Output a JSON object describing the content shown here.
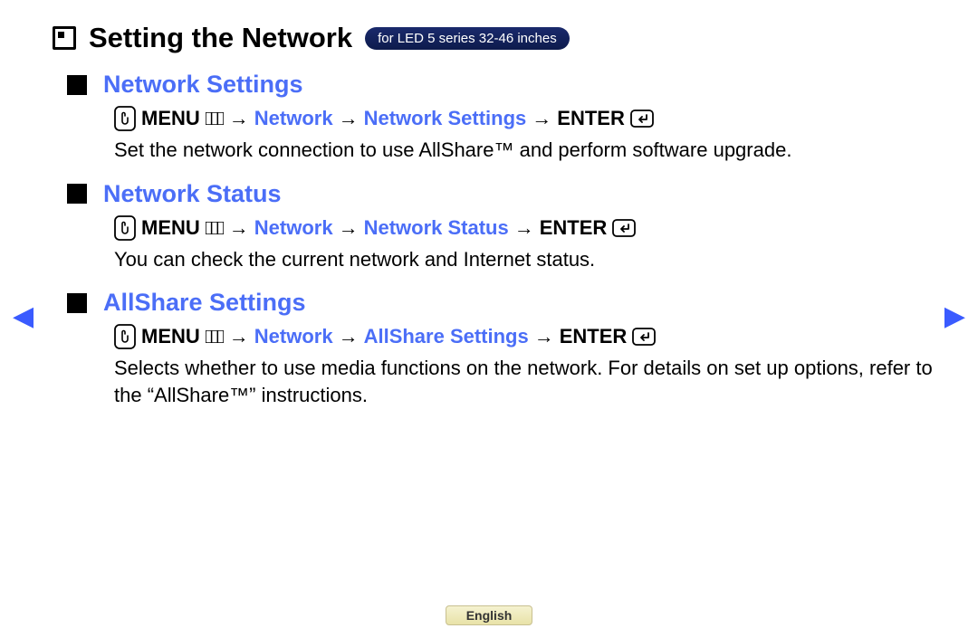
{
  "page": {
    "title": "Setting the Network",
    "pill": "for LED 5 series 32-46 inches",
    "language": "English"
  },
  "arrow": "→",
  "menu_label": "MENU",
  "enter_label": "ENTER",
  "sections": [
    {
      "title": "Network Settings",
      "path": {
        "a": "Network",
        "b": "Network Settings"
      },
      "desc": "Set the network connection to use AllShare™ and perform software upgrade."
    },
    {
      "title": "Network Status",
      "path": {
        "a": "Network",
        "b": "Network Status"
      },
      "desc": "You can check the current network and Internet status."
    },
    {
      "title": "AllShare Settings",
      "path": {
        "a": "Network",
        "b": "AllShare Settings"
      },
      "desc": "Selects whether to use media functions on the network. For details on set up options, refer to the “AllShare™” instructions."
    }
  ]
}
